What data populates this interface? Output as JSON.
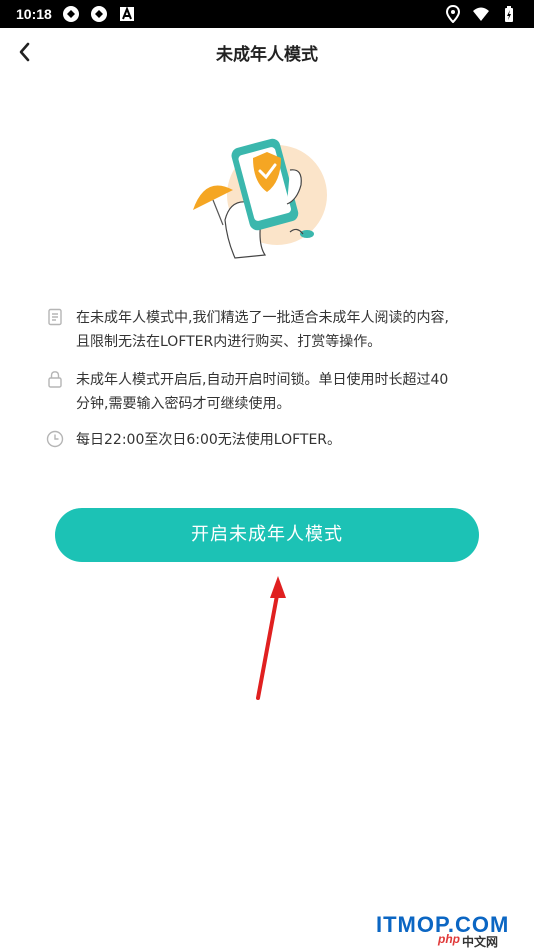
{
  "status_bar": {
    "time": "10:18",
    "left_icons": [
      "sync-icon",
      "sync-icon",
      "a-icon"
    ],
    "right_icons": [
      "location-icon",
      "wifi-icon",
      "battery-icon"
    ]
  },
  "header": {
    "title": "未成年人模式",
    "back_icon": "back-chevron-icon"
  },
  "illustration": {
    "icon": "phone-shield-illustration",
    "colors": {
      "circle": "#fbe4c9",
      "phone": "#3bb7ad",
      "shield": "#f5a623",
      "umbrella": "#f5a623"
    }
  },
  "info_items": [
    {
      "icon": "document-icon",
      "text_line1": "在未成年人模式中,我们精选了一批适合未成年人阅读的内容,",
      "text_line2": "且限制无法在LOFTER内进行购买、打赏等操作。"
    },
    {
      "icon": "lock-icon",
      "text_line1": "未成年人模式开启后,自动开启时间锁。单日使用时长超过40",
      "text_line2": "分钟,需要输入密码才可继续使用。"
    },
    {
      "icon": "clock-icon",
      "text_line1": "每日22:00至次日6:00无法使用LOFTER。",
      "text_line2": ""
    }
  ],
  "cta": {
    "label": "开启未成年人模式",
    "color": "#1cc2b5"
  },
  "annotation": {
    "icon": "red-arrow-icon",
    "color": "#e02020"
  },
  "watermark": {
    "main": "ITMOP.COM",
    "php": "php",
    "cn": "中文网"
  }
}
